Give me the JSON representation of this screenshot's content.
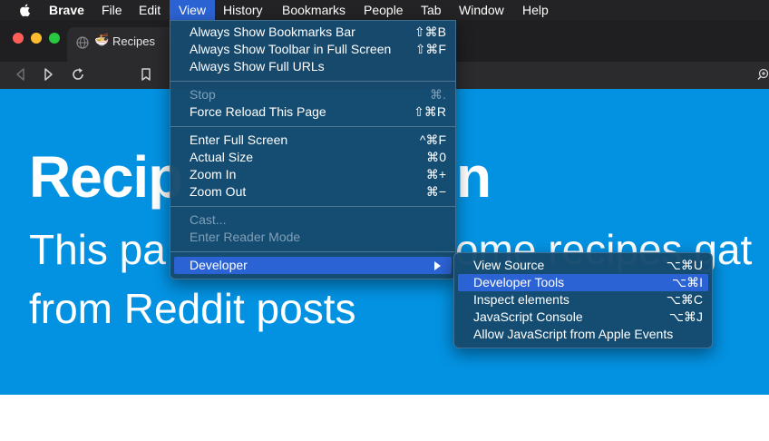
{
  "menubar": {
    "app": "Brave",
    "items": [
      "File",
      "Edit",
      "View",
      "History",
      "Bookmarks",
      "People",
      "Tab",
      "Window",
      "Help"
    ]
  },
  "tab": {
    "emoji": "🍜",
    "title": "Recipes"
  },
  "page": {
    "heading_visible": "Recip",
    "heading_tail": "n",
    "subtitle_line1_left": "This pa",
    "subtitle_line1_right": "ome recipes gat",
    "subtitle_line2": "from Reddit posts"
  },
  "view_menu": {
    "always_show_bookmarks_bar": {
      "label": "Always Show Bookmarks Bar",
      "shortcut": "⇧⌘B"
    },
    "always_show_toolbar_fullscreen": {
      "label": "Always Show Toolbar in Full Screen",
      "shortcut": "⇧⌘F"
    },
    "always_show_full_urls": {
      "label": "Always Show Full URLs"
    },
    "stop": {
      "label": "Stop",
      "shortcut": "⌘."
    },
    "force_reload": {
      "label": "Force Reload This Page",
      "shortcut": "⇧⌘R"
    },
    "enter_full_screen": {
      "label": "Enter Full Screen",
      "shortcut": "^⌘F"
    },
    "actual_size": {
      "label": "Actual Size",
      "shortcut": "⌘0"
    },
    "zoom_in": {
      "label": "Zoom In",
      "shortcut": "⌘+"
    },
    "zoom_out": {
      "label": "Zoom Out",
      "shortcut": "⌘−"
    },
    "cast": {
      "label": "Cast..."
    },
    "enter_reader_mode": {
      "label": "Enter Reader Mode"
    },
    "developer": {
      "label": "Developer"
    }
  },
  "developer_menu": {
    "view_source": {
      "label": "View Source",
      "shortcut": "⌥⌘U"
    },
    "developer_tools": {
      "label": "Developer Tools",
      "shortcut": "⌥⌘I"
    },
    "inspect_elements": {
      "label": "Inspect elements",
      "shortcut": "⌥⌘C"
    },
    "javascript_console": {
      "label": "JavaScript Console",
      "shortcut": "⌥⌘J"
    },
    "allow_js_apple_events": {
      "label": "Allow JavaScript from Apple Events"
    }
  },
  "colors": {
    "menu_highlight": "#2c63d4",
    "page_background": "#0392e2",
    "menu_background": "#164a6e"
  }
}
